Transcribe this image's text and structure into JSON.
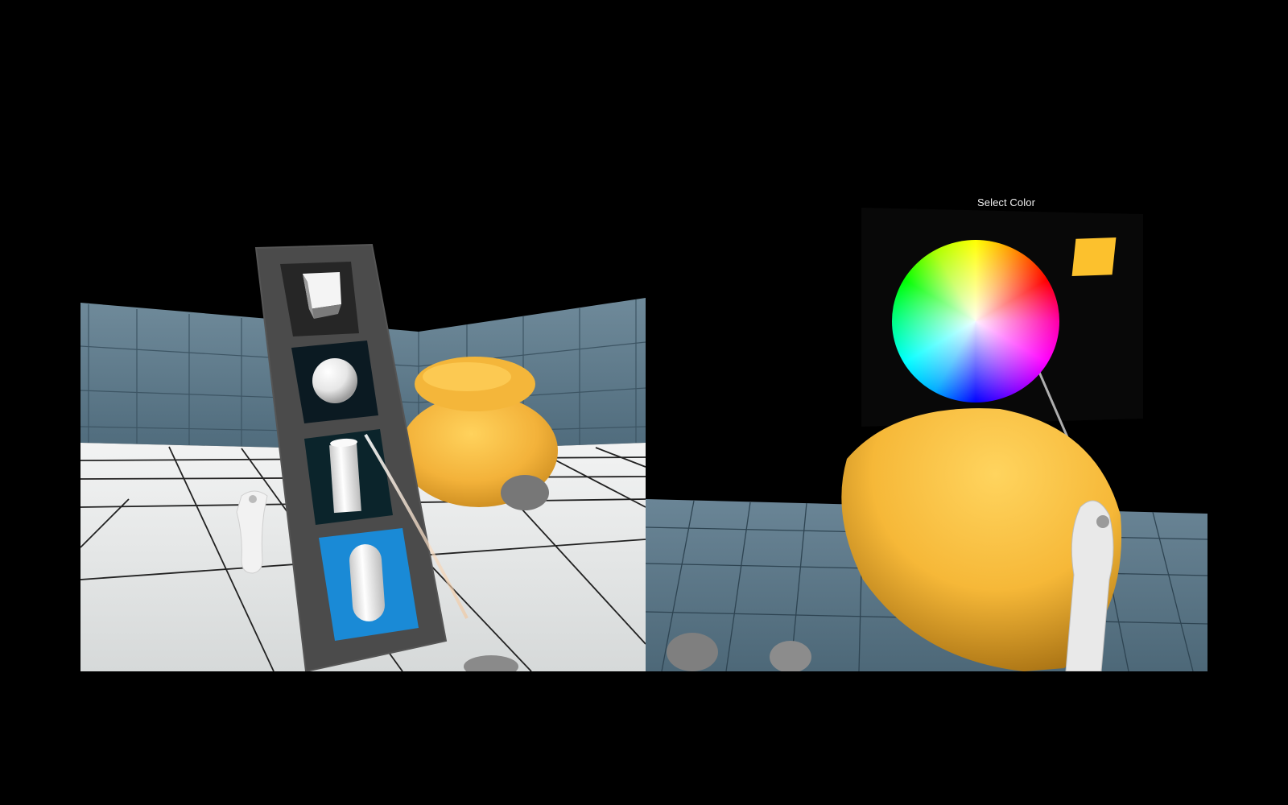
{
  "color_picker": {
    "title": "Select Color",
    "selected_color": "#fcc12d"
  },
  "shape_palette": {
    "items": [
      "cube-icon",
      "sphere-icon",
      "cylinder-icon",
      "capsule-icon"
    ],
    "selected": "capsule-icon",
    "selected_color": "#1a8ad6"
  },
  "colors": {
    "background": "#000000",
    "wall": "#5d7a8c",
    "floor": "#d9dcdc",
    "object": "#f4b63a",
    "panel": "#4a4a4a"
  }
}
